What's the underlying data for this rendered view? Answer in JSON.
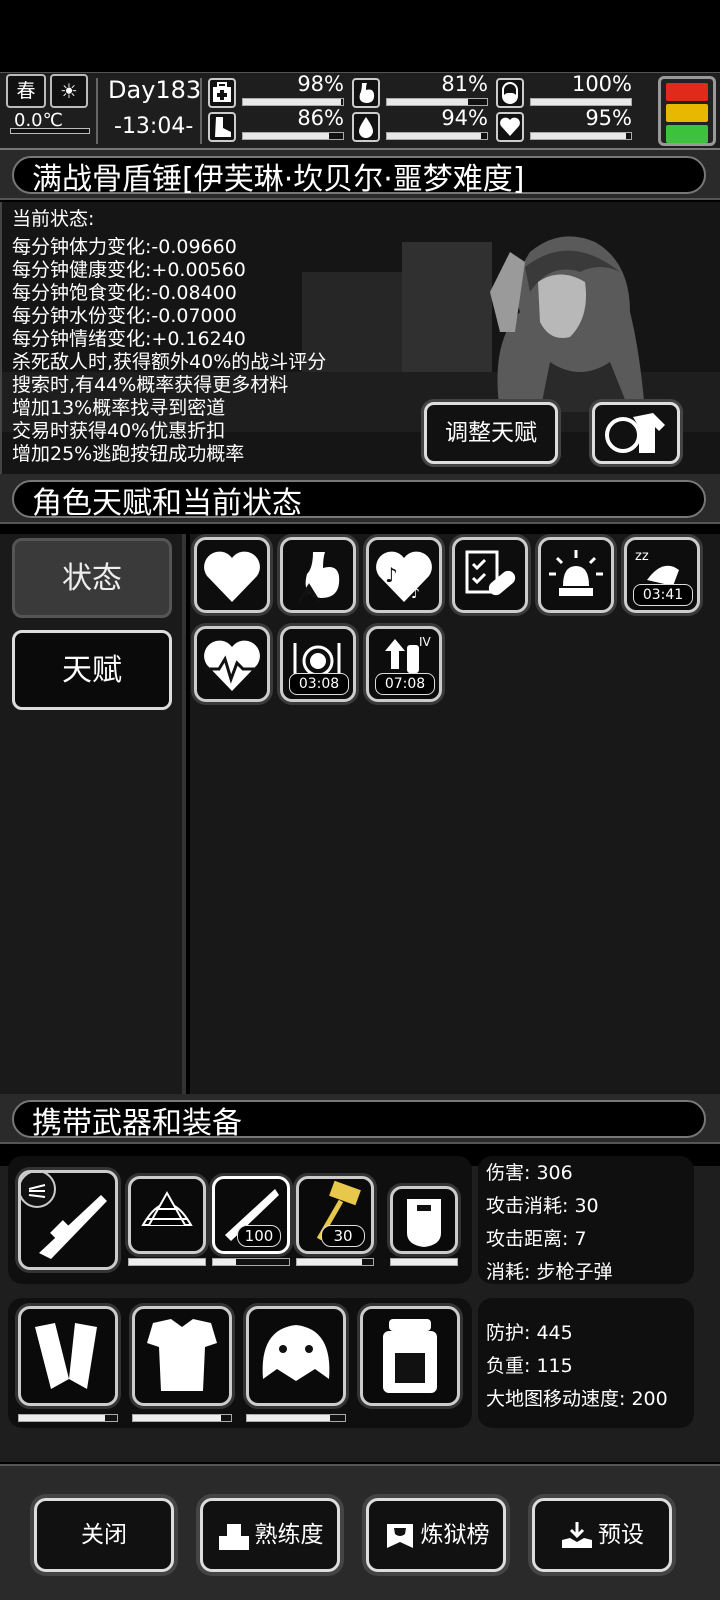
{
  "status_bar": {
    "season": "春",
    "temperature": "0.0℃",
    "day": "Day183",
    "time": "-13:04-",
    "stats": [
      {
        "icon": "medkit-icon",
        "value": "98%",
        "fraction": 0.98
      },
      {
        "icon": "stomach-icon",
        "value": "81%",
        "fraction": 0.81
      },
      {
        "icon": "capsule-icon",
        "value": "100%",
        "fraction": 1.0
      },
      {
        "icon": "boot-icon",
        "value": "86%",
        "fraction": 0.86
      },
      {
        "icon": "water-drop-icon",
        "value": "94%",
        "fraction": 0.94
      },
      {
        "icon": "heart-icon",
        "value": "95%",
        "fraction": 0.95
      }
    ],
    "traffic_colors": [
      "#e02a1a",
      "#e8b800",
      "#3cc23c"
    ]
  },
  "character": {
    "title": "满战骨盾锤[伊芙琳·坎贝尔·噩梦难度]",
    "lines": [
      "当前状态:",
      "每分钟体力变化:-0.09660",
      "每分钟健康变化:+0.00560",
      "每分钟饱食变化:-0.08400",
      "每分钟水份变化:-0.07000",
      "每分钟情绪变化:+0.16240",
      "杀死敌人时,获得额外40%的战斗评分",
      "搜索时,有44%概率获得更多材料",
      "增加13%概率找寻到密道",
      "交易时获得40%优惠折扣",
      "增加25%逃跑按钮成功概率"
    ],
    "adjust_button": "调整天赋"
  },
  "talents": {
    "header": "角色天赋和当前状态",
    "tabs": [
      "状态",
      "天赋"
    ],
    "timers": [
      "03:41",
      "03:08",
      "07:08"
    ],
    "tier": "IV"
  },
  "equipment": {
    "header": "携带武器和装备",
    "ammo_counts": [
      "100",
      "30"
    ],
    "weapon_stats": [
      "伤害: 306",
      "攻击消耗: 30",
      "攻击距离: 7",
      "消耗: 步枪子弹"
    ],
    "armor_stats": [
      "防护: 445",
      "负重: 115",
      "大地图移动速度: 200"
    ]
  },
  "bottom_buttons": [
    "关闭",
    "熟练度",
    "炼狱榜",
    "预设"
  ]
}
